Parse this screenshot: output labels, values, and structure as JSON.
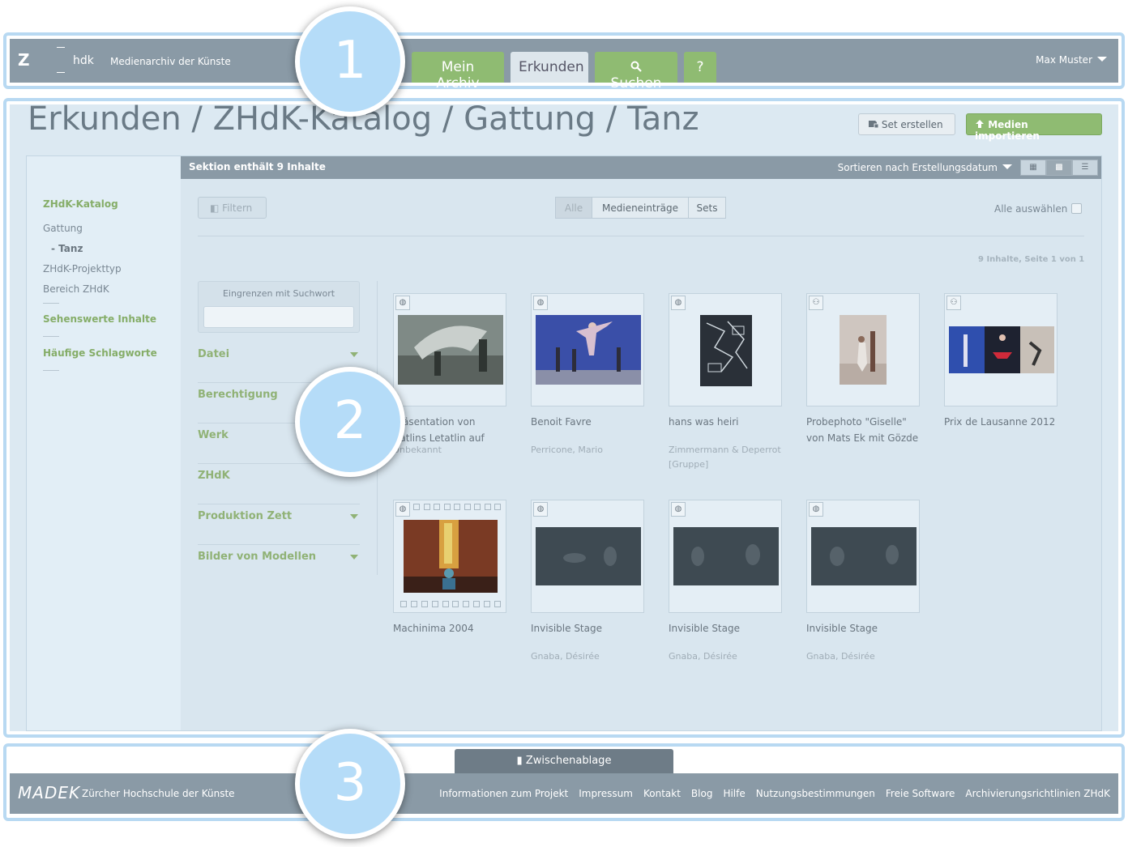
{
  "colors": {
    "accent_green": "#8fbb72",
    "bar_gray": "#8a9aa6",
    "highlight_blue": "#b5dcf8"
  },
  "header": {
    "logo_letter": "Z",
    "logo_hdk": "hdk",
    "app_title": "Medienarchiv der Künste",
    "tabs": [
      {
        "label": "Mein Archiv",
        "active": false
      },
      {
        "label": "Erkunden",
        "active": true
      },
      {
        "label": "Suchen",
        "icon": "search-icon",
        "active": false
      },
      {
        "label": "?",
        "active": false
      }
    ],
    "user": "Max Muster"
  },
  "page": {
    "title": "Erkunden / ZHdK-Katalog / Gattung / Tanz",
    "btn_set": "Set erstellen",
    "btn_import": "Medien importieren"
  },
  "sidebar": {
    "catalog": "ZHdK-Katalog",
    "gattung": "Gattung",
    "tanz": "- Tanz",
    "projekttyp": "ZHdK-Projekttyp",
    "bereich": "Bereich ZHdK",
    "sehenswerte": "Sehenswerte Inhalte",
    "schlagworte": "Häufige Schlagworte"
  },
  "section": {
    "count": "Sektion enthält 9 Inhalte",
    "sort": "Sortieren nach Erstellungsdatum",
    "view_icons": [
      "grid-small-icon",
      "grid-large-icon",
      "list-icon"
    ]
  },
  "filters": {
    "filter_btn": "Filtern",
    "segments": [
      "Alle",
      "Medieneinträge",
      "Sets"
    ],
    "select_all": "Alle auswählen",
    "pagination": "9 Inhalte, Seite 1 von 1",
    "refine_label": "Eingrenzen mit Suchwort",
    "facets": [
      "Datei",
      "Berechtigung",
      "Werk",
      "ZHdK",
      "Produktion Zett",
      "Bilder von Modellen"
    ]
  },
  "cards": [
    {
      "title_line1": "Präsentation von",
      "title_line2": "Catlins Letatlin auf",
      "author": "Unbekannt",
      "icon": "globe-icon"
    },
    {
      "title_line1": "Benoit Favre",
      "title_line2": "",
      "author": "Perricone, Mario",
      "icon": "globe-icon"
    },
    {
      "title_line1": "hans was heiri",
      "title_line2": "",
      "author": "Zimmermann & Deperrot",
      "author2": "[Gruppe]",
      "icon": "globe-icon"
    },
    {
      "title_line1": "Probephoto \"Giselle\"",
      "title_line2": "von Mats Ek mit Gözde",
      "author": "",
      "icon": "group-icon"
    },
    {
      "title_line1": "Prix de Lausanne 2012",
      "title_line2": "",
      "author": "",
      "icon": "group-icon"
    },
    {
      "title_line1": "Machinima 2004",
      "title_line2": "",
      "author": "",
      "icon": "globe-icon"
    },
    {
      "title_line1": "Invisible Stage",
      "title_line2": "",
      "author": "Gnaba, Désirée",
      "icon": "globe-icon"
    },
    {
      "title_line1": "Invisible Stage",
      "title_line2": "",
      "author": "Gnaba, Désirée",
      "icon": "globe-icon"
    },
    {
      "title_line1": "Invisible Stage",
      "title_line2": "",
      "author": "Gnaba, Désirée",
      "icon": "globe-icon"
    }
  ],
  "footer": {
    "clipboard": "Zwischenablage",
    "logo": "MADEK",
    "institution": "Zürcher Hochschule der Künste",
    "links": [
      "Informationen zum Projekt",
      "Impressum",
      "Kontakt",
      "Blog",
      "Hilfe",
      "Nutzungsbestimmungen",
      "Freie Software",
      "Archivierungsrichtlinien ZHdK"
    ]
  },
  "markers": [
    "1",
    "2",
    "3"
  ]
}
